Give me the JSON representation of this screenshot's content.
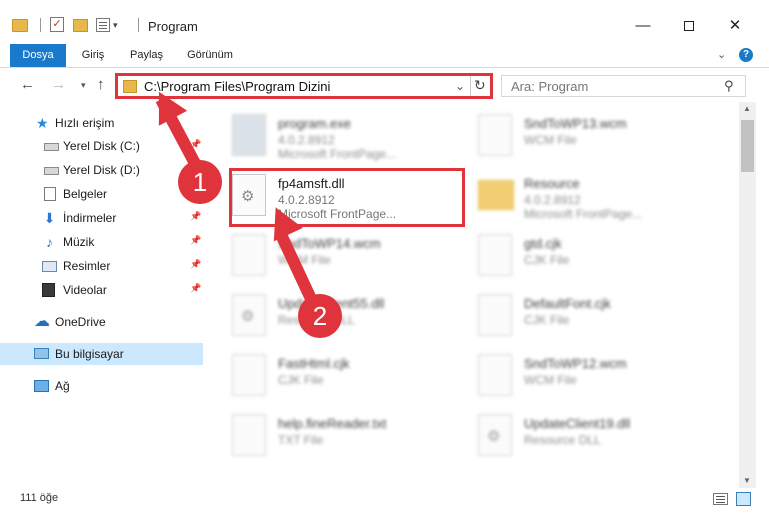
{
  "window": {
    "title": "Program",
    "minimize_glyph": "—",
    "close_glyph": "✕"
  },
  "ribbon": {
    "tabs": [
      {
        "label": "Dosya"
      },
      {
        "label": "Giriş"
      },
      {
        "label": "Paylaş"
      },
      {
        "label": "Görünüm"
      }
    ],
    "help_label": "?"
  },
  "address": {
    "path": "C:\\Program Files\\Program Dizini",
    "search_placeholder": "Ara: Program"
  },
  "navigation": {
    "items": [
      {
        "label": "Hızlı erişim",
        "icon": "star-icon"
      },
      {
        "label": "Yerel Disk (C:)",
        "icon": "drive-icon"
      },
      {
        "label": "Yerel Disk (D:)",
        "icon": "drive-icon"
      },
      {
        "label": "Belgeler",
        "icon": "documents-icon"
      },
      {
        "label": "İndirmeler",
        "icon": "download-icon"
      },
      {
        "label": "Müzik",
        "icon": "music-icon"
      },
      {
        "label": "Resimler",
        "icon": "pictures-icon"
      },
      {
        "label": "Videolar",
        "icon": "videos-icon"
      },
      {
        "label": "OneDrive",
        "icon": "cloud-icon"
      },
      {
        "label": "Bu bilgisayar",
        "icon": "computer-icon",
        "selected": true
      },
      {
        "label": "Ağ",
        "icon": "network-icon"
      }
    ]
  },
  "files": [
    {
      "name": "program.exe",
      "line1": "4.0.2.8912",
      "line2": "Microsoft FrontPage...",
      "icon": "exe-icon"
    },
    {
      "name": "SndToWP13.wcm",
      "line1": "WCM File",
      "line2": "",
      "icon": "file-icon"
    },
    {
      "name": "fp4amsft.dll",
      "line1": "4.0.2.8912",
      "line2": "Microsoft FrontPage...",
      "icon": "dll-icon",
      "highlighted": true
    },
    {
      "name": "Resource",
      "line1": "4.0.2.8912",
      "line2": "Microsoft FrontPage...",
      "icon": "folder-icon"
    },
    {
      "name": "SndToWP14.wcm",
      "line1": "WCM File",
      "line2": "",
      "icon": "file-icon"
    },
    {
      "name": "gtd.cjk",
      "line1": "CJK File",
      "line2": "",
      "icon": "file-icon"
    },
    {
      "name": "UpdateClient55.dll",
      "line1": "Resource DLL",
      "line2": "",
      "icon": "dll-icon"
    },
    {
      "name": "DefaultFont.cjk",
      "line1": "CJK File",
      "line2": "",
      "icon": "file-icon"
    },
    {
      "name": "FastHtml.cjk",
      "line1": "CJK File",
      "line2": "",
      "icon": "file-icon"
    },
    {
      "name": "SndToWP12.wcm",
      "line1": "WCM File",
      "line2": "",
      "icon": "file-icon"
    },
    {
      "name": "help.fineReader.txt",
      "line1": "TXT File",
      "line2": "",
      "icon": "file-icon"
    },
    {
      "name": "UpdateClient19.dll",
      "line1": "Resource DLL",
      "line2": "",
      "icon": "dll-icon"
    }
  ],
  "status": {
    "item_count": "111 öğe"
  },
  "annotations": {
    "step1": "1",
    "step2": "2",
    "color": "#e0343c"
  }
}
